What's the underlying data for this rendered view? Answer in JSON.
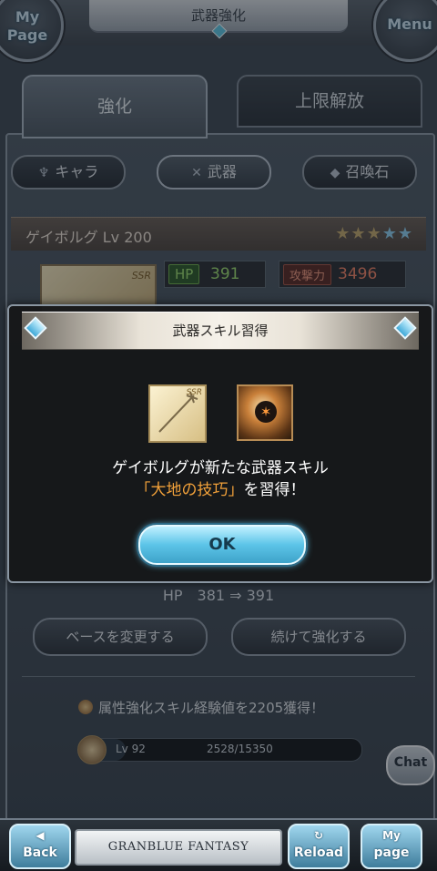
{
  "header": {
    "title": "武器強化",
    "left_button": "My Page",
    "left_button_l1": "My",
    "left_button_l2": "Page",
    "right_button": "Menu"
  },
  "tabs": [
    {
      "label": "強化",
      "active": true
    },
    {
      "label": "上限解放",
      "active": false
    }
  ],
  "categories": [
    {
      "label": "キャラ",
      "icon": "character-icon"
    },
    {
      "label": "武器",
      "icon": "weapon-icon",
      "active": true
    },
    {
      "label": "召喚石",
      "icon": "summon-stone-icon"
    }
  ],
  "weapon": {
    "name": "ゲイボルグ Lv 200",
    "rarity": "SSR",
    "stars": "★★★★★",
    "hp_label": "HP",
    "hp_value": "391",
    "atk_label": "攻撃力",
    "atk_value": "3496"
  },
  "modal": {
    "title": "武器スキル習得",
    "weapon_rarity": "SSR",
    "message_line1": "ゲイボルグが新たな武器スキル",
    "skill_name": "「大地の技巧」",
    "message_line2_suffix": "を習得！",
    "ok_label": "OK"
  },
  "result": {
    "hp_change": "HP　381 ⇒ 391",
    "base_button": "ベースを変更する",
    "continue_button": "続けて強化する",
    "exp_message": "属性強化スキル経験値を2205獲得！",
    "level": "Lv 92",
    "exp": "2528/15350",
    "exp_fraction": 0.165
  },
  "chat_label": "Chat",
  "bottom_nav": {
    "back_l1": "◀",
    "back_l2": "Back",
    "logo": "GRANBLUE FANTASY",
    "reload_l1": "↻",
    "reload_l2": "Reload",
    "mypage_l1": "My",
    "mypage_l2": "page"
  },
  "colors": {
    "accent": "#5cc4e8",
    "skill_name": "#f2a13a",
    "hp_green": "#9fe071",
    "atk_red": "#f48466"
  }
}
